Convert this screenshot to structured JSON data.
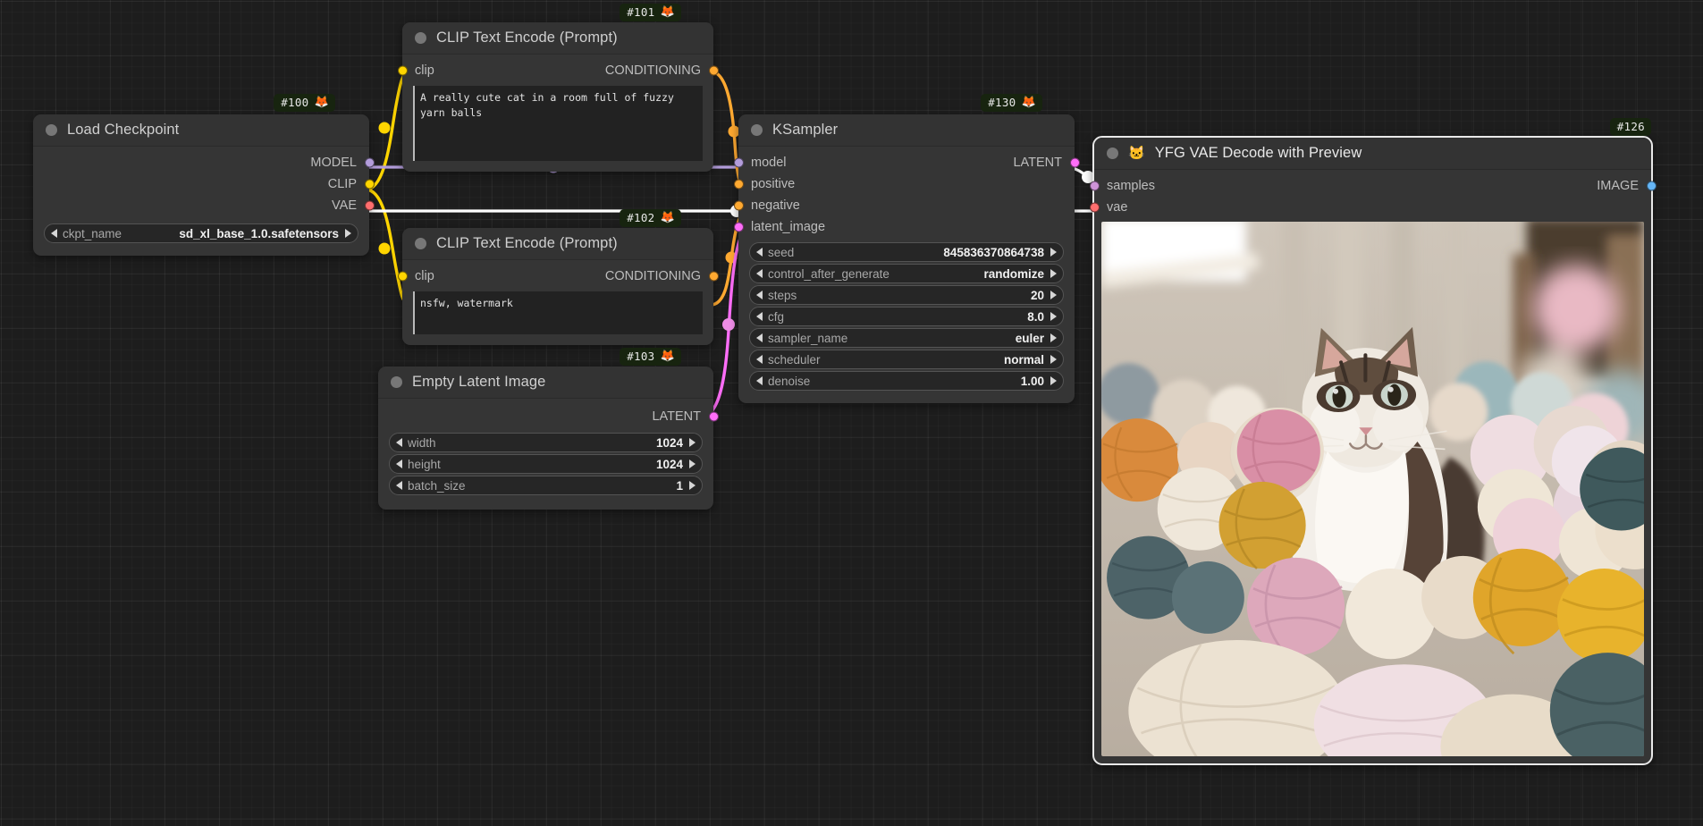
{
  "canvas": {
    "background": "#1d1d1d",
    "grid_minor": "#242424",
    "grid_major": "#2a2a2a"
  },
  "colors": {
    "model": "#b39ddb",
    "clip": "#ffd500",
    "vae": "#ff6e6e",
    "conditioning": "#ffa931",
    "latent": "#ff6ef9",
    "image": "#64b5f6",
    "wire_highlight": "#ffffff",
    "node_bg": "#353535",
    "node_title_bg": "#333333",
    "badge_bg": "#17240f"
  },
  "nodes": [
    {
      "id": "load-checkpoint",
      "badge": {
        "text": "#100",
        "emoji": "🦊"
      },
      "title": "Load Checkpoint",
      "title_emoji": "",
      "outputs": [
        {
          "name": "MODEL",
          "color": "#b39ddb"
        },
        {
          "name": "CLIP",
          "color": "#ffd500"
        },
        {
          "name": "VAE",
          "color": "#ff6e6e"
        }
      ],
      "inputs": [],
      "widgets": [
        {
          "name": "ckpt_name",
          "value": "sd_xl_base_1.0.safetensors"
        }
      ]
    },
    {
      "id": "clip-text-encode-positive",
      "badge": {
        "text": "#101",
        "emoji": "🦊"
      },
      "title": "CLIP Text Encode (Prompt)",
      "title_emoji": "",
      "inputs": [
        {
          "name": "clip",
          "color": "#ffd500"
        }
      ],
      "outputs": [
        {
          "name": "CONDITIONING",
          "color": "#ffa931"
        }
      ],
      "text": "A really cute cat in a room full of fuzzy yarn balls"
    },
    {
      "id": "clip-text-encode-negative",
      "badge": {
        "text": "#102",
        "emoji": "🦊"
      },
      "title": "CLIP Text Encode (Prompt)",
      "title_emoji": "",
      "inputs": [
        {
          "name": "clip",
          "color": "#ffd500"
        }
      ],
      "outputs": [
        {
          "name": "CONDITIONING",
          "color": "#ffa931"
        }
      ],
      "text": "nsfw, watermark"
    },
    {
      "id": "empty-latent-image",
      "badge": {
        "text": "#103",
        "emoji": "🦊"
      },
      "title": "Empty Latent Image",
      "title_emoji": "",
      "inputs": [],
      "outputs": [
        {
          "name": "LATENT",
          "color": "#ff6ef9"
        }
      ],
      "widgets": [
        {
          "name": "width",
          "value": "1024"
        },
        {
          "name": "height",
          "value": "1024"
        },
        {
          "name": "batch_size",
          "value": "1"
        }
      ]
    },
    {
      "id": "ksampler",
      "badge": {
        "text": "#130",
        "emoji": "🦊"
      },
      "title": "KSampler",
      "title_emoji": "",
      "inputs": [
        {
          "name": "model",
          "color": "#b39ddb"
        },
        {
          "name": "positive",
          "color": "#ffa931"
        },
        {
          "name": "negative",
          "color": "#ffa931"
        },
        {
          "name": "latent_image",
          "color": "#ff6ef9"
        }
      ],
      "outputs": [
        {
          "name": "LATENT",
          "color": "#ff6ef9"
        }
      ],
      "widgets": [
        {
          "name": "seed",
          "value": "845836370864738"
        },
        {
          "name": "control_after_generate",
          "value": "randomize"
        },
        {
          "name": "steps",
          "value": "20"
        },
        {
          "name": "cfg",
          "value": "8.0"
        },
        {
          "name": "sampler_name",
          "value": "euler"
        },
        {
          "name": "scheduler",
          "value": "normal"
        },
        {
          "name": "denoise",
          "value": "1.00"
        }
      ]
    },
    {
      "id": "yfg-vae-decode-with-preview",
      "badge": {
        "text": "#126",
        "emoji": ""
      },
      "title": "YFG VAE Decode with Preview",
      "title_emoji": "🐱",
      "inputs": [
        {
          "name": "samples",
          "color": "#ce93d8"
        },
        {
          "name": "vae",
          "color": "#ff6e6e"
        }
      ],
      "outputs": [
        {
          "name": "IMAGE",
          "color": "#64b5f6"
        }
      ],
      "preview": {
        "alt": "Generated image: a fluffy tabby-and-white cat sitting among many pastel yarn balls in a sunlit room"
      }
    }
  ],
  "links": [
    {
      "from": "load-checkpoint.MODEL",
      "to": "ksampler.model",
      "color": "#b39ddb"
    },
    {
      "from": "load-checkpoint.CLIP",
      "to": "clip-text-encode-positive.clip",
      "color": "#ffd500"
    },
    {
      "from": "load-checkpoint.CLIP",
      "to": "clip-text-encode-negative.clip",
      "color": "#ffd500"
    },
    {
      "from": "load-checkpoint.VAE",
      "to": "yfg-vae-decode-with-preview.vae",
      "color": "#ffffff"
    },
    {
      "from": "clip-text-encode-positive.CONDITIONING",
      "to": "ksampler.positive",
      "color": "#ffa931"
    },
    {
      "from": "clip-text-encode-negative.CONDITIONING",
      "to": "ksampler.negative",
      "color": "#ffa931"
    },
    {
      "from": "empty-latent-image.LATENT",
      "to": "ksampler.latent_image",
      "color": "#ff6ef9"
    },
    {
      "from": "ksampler.LATENT",
      "to": "yfg-vae-decode-with-preview.samples",
      "color": "#ffffff"
    }
  ]
}
